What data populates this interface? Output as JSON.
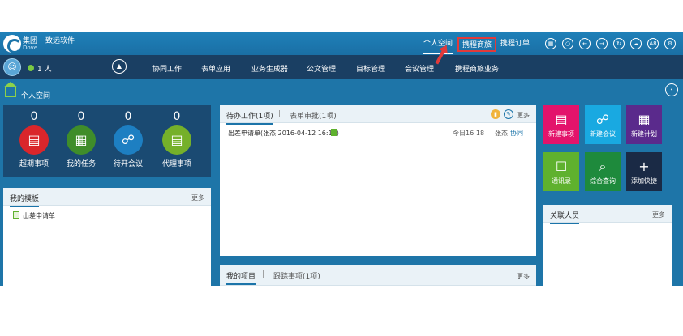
{
  "header": {
    "brand_cn": "集团",
    "brand_sub": "致远软件",
    "brand_en": "Dove",
    "tabs": [
      "个人空间",
      "携程商旅",
      "携程订单"
    ],
    "icons": [
      "grid-icon",
      "search-icon",
      "back-icon",
      "forward-icon",
      "refresh-icon",
      "cloud-icon",
      "a8-icon",
      "settings-icon"
    ],
    "a8_label": "A8"
  },
  "nav": {
    "online_count": "1 人",
    "items": [
      "协同工作",
      "表单应用",
      "业务生成器",
      "公文管理",
      "目标管理",
      "会议管理",
      "携程商旅业务"
    ]
  },
  "breadcrumb": {
    "title": "个人空间"
  },
  "stats": [
    {
      "count": "0",
      "label": "超期事项",
      "color": "#d9262b",
      "glyph": "▤"
    },
    {
      "count": "0",
      "label": "我的任务",
      "color": "#3f8d2a",
      "glyph": "▦"
    },
    {
      "count": "0",
      "label": "待开会议",
      "color": "#1d7fc2",
      "glyph": "☍"
    },
    {
      "count": "0",
      "label": "代理事项",
      "color": "#75b02a",
      "glyph": "▤"
    }
  ],
  "templates": {
    "title": "我的模板",
    "more": "更多",
    "items": [
      "出差申请单"
    ]
  },
  "pending": {
    "tab1": "待办工作(1项)",
    "separator": "|",
    "tab2": "表单审批(1项)",
    "more": "更多",
    "rows": [
      {
        "title": "出差申请单(张杰 2016-04-12 16:13)",
        "time": "今日16:18",
        "user": "张杰",
        "type": "协同"
      }
    ]
  },
  "projects": {
    "tab1": "我的项目",
    "separator": "|",
    "tab2": "跟踪事项(1项)",
    "more": "更多"
  },
  "tiles": [
    {
      "label": "新建事项",
      "color": "#e3136b",
      "glyph": "▤"
    },
    {
      "label": "新建会议",
      "color": "#19a9e1",
      "glyph": "☍"
    },
    {
      "label": "新建计划",
      "color": "#5a2a8c",
      "glyph": "▦"
    },
    {
      "label": "通讯录",
      "color": "#5fb12e",
      "glyph": "☐"
    },
    {
      "label": "综合查询",
      "color": "#1e8a3c",
      "glyph": "⌕"
    },
    {
      "label": "添加快捷",
      "color": "#1a2a45",
      "glyph": "+"
    }
  ],
  "related": {
    "title": "关联人员",
    "more": "更多"
  }
}
